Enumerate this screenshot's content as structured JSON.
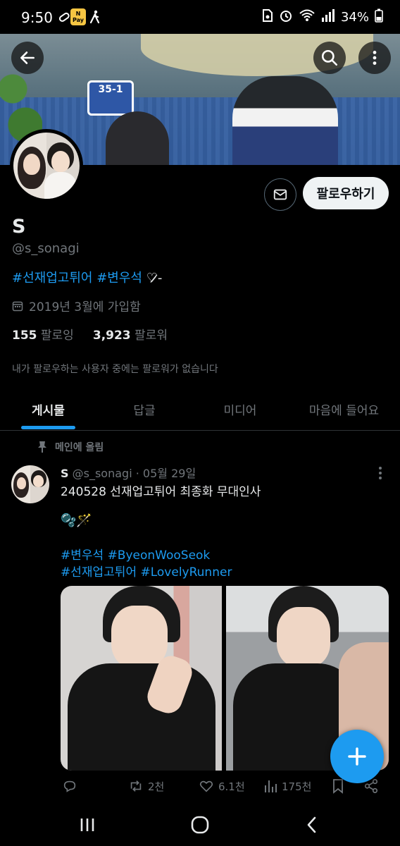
{
  "status_bar": {
    "time": "9:50",
    "battery": "34%",
    "pay_badge_top": "N",
    "pay_badge_bottom": "Pay",
    "icons": [
      "pill-icon",
      "pay-icon",
      "walk-icon",
      "sim-icon",
      "alarm-icon",
      "wifi-icon",
      "signal-icon",
      "battery-icon"
    ]
  },
  "banner": {
    "sign_text_top": "35-1",
    "sign_text_bottom": ""
  },
  "profile": {
    "name": "S",
    "handle": "@s_sonagi",
    "bio_tag1": "#선재업고튀어",
    "bio_tag2": "#변우석",
    "bio_suffix": "♡̷̷-",
    "joined": "2019년 3월에 가입함",
    "following_count": "155",
    "following_label": "팔로잉",
    "followers_count": "3,923",
    "followers_label": "팔로워",
    "no_mutual": "내가 팔로우하는 사용자 중에는 팔로워가 없습니다",
    "follow_button": "팔로우하기"
  },
  "tabs": [
    {
      "label": "게시물",
      "active": true
    },
    {
      "label": "답글",
      "active": false
    },
    {
      "label": "미디어",
      "active": false
    },
    {
      "label": "마음에 들어요",
      "active": false
    }
  ],
  "tweet": {
    "pinned_label": "메인에 올림",
    "author_name": "S",
    "author_handle": "@s_sonagi",
    "date": "05월 29일",
    "text": "240528 선재업고튀어 최종화 무대인사",
    "emoji": "🫧🪄",
    "tags_line1": "#변우석 #ByeonWooSeok",
    "tags_line2": "#선재업고튀어 #LovelyRunner",
    "retweets": "2천",
    "likes": "6.1천",
    "views": "175천"
  },
  "colors": {
    "accent": "#1d9bf0",
    "background": "#000000",
    "muted": "#71767b"
  }
}
